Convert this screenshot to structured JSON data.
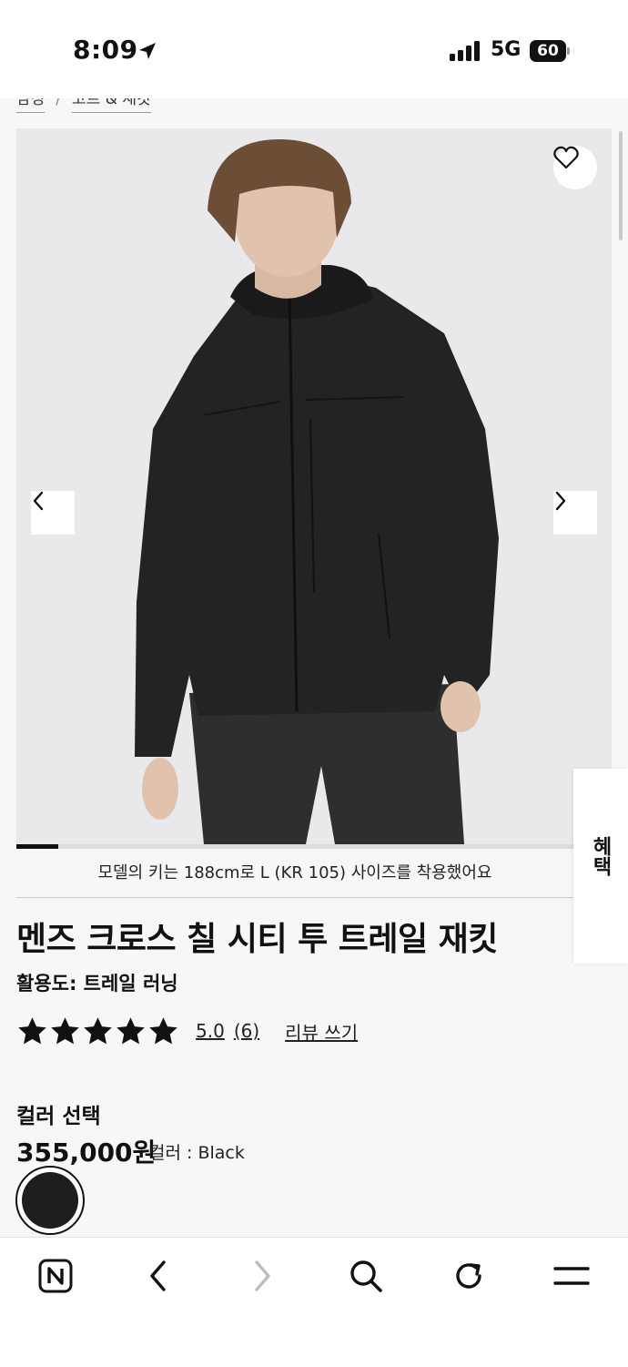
{
  "status_bar": {
    "time": "8:09",
    "network": "5G",
    "battery": "60"
  },
  "breadcrumb": {
    "items": [
      "남성",
      "코트 & 재킷"
    ],
    "separator": "/"
  },
  "product": {
    "model_note": "모델의 키는 188cm로 L (KR 105) 사이즈를 착용했어요",
    "title": "멘즈 크로스 칠 시티 투 트레일 재킷",
    "activity": "활용도: 트레일 러닝",
    "rating": "5.0",
    "review_count": "(6)",
    "write_review": "리뷰 쓰기",
    "stars": 5,
    "color_heading": "컬러 선택",
    "price": "355,000원",
    "color_label": "컬러 : Black",
    "swatch_color": "#1e1e1e",
    "gallery_progress": 0.07
  },
  "side_tab": {
    "label": "혜택"
  },
  "icons": {
    "wishlist": "heart-icon",
    "prev": "chevron-left-icon",
    "next": "chevron-right-icon",
    "star": "star-icon"
  },
  "browser_bar": {
    "items": [
      "naver-logo-icon",
      "back-arrow-icon",
      "forward-arrow-icon",
      "search-icon",
      "reload-icon",
      "menu-icon"
    ]
  },
  "colors": {
    "accent": "#111111",
    "page_bg": "#f7f7f7",
    "hero_bg": "#e9e9eb"
  }
}
